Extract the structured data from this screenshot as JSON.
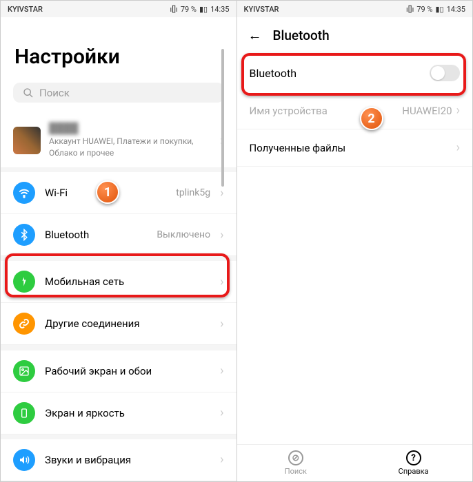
{
  "status": {
    "carrier": "KYIVSTAR",
    "battery": "79 %",
    "time": "14:35",
    "vibrate_icon": "ı[]ı"
  },
  "left": {
    "title": "Настройки",
    "search_placeholder": "Поиск",
    "account_name": "████",
    "account_sub": "Аккаунт HUAWEI, Платежи и покупки, Облако и прочее",
    "rows": {
      "wifi": {
        "label": "Wi-Fi",
        "value": "tplink5g"
      },
      "bluetooth": {
        "label": "Bluetooth",
        "value": "Выключено"
      },
      "mobile": {
        "label": "Мобильная сеть"
      },
      "connections": {
        "label": "Другие соединения"
      },
      "wallpaper": {
        "label": "Рабочий экран и обои"
      },
      "screen": {
        "label": "Экран и яркость"
      },
      "sound": {
        "label": "Звуки и вибрация"
      }
    }
  },
  "right": {
    "header": "Bluetooth",
    "toggle_label": "Bluetooth",
    "device_name_label": "Имя устройства",
    "device_name_value": "HUAWEI20",
    "received_label": "Полученные файлы",
    "nav_search": "Поиск",
    "nav_help": "Справка"
  },
  "steps": {
    "one": "1",
    "two": "2"
  }
}
